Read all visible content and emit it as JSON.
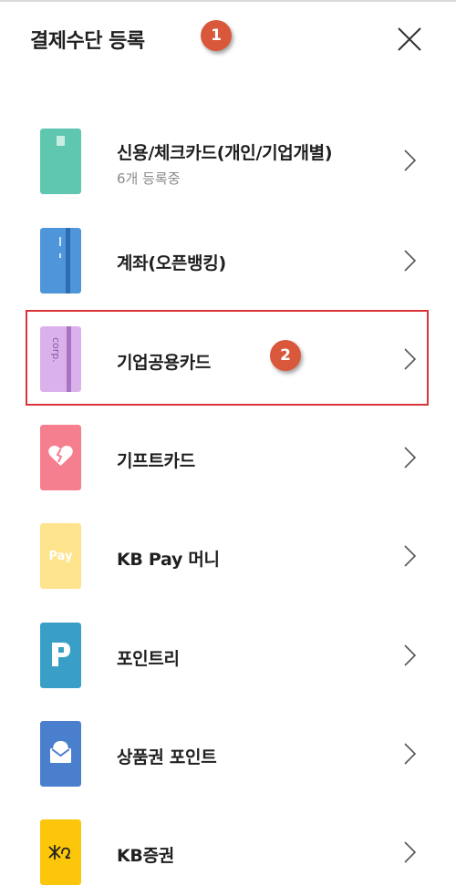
{
  "header": {
    "title": "결제수단 등록"
  },
  "badges": {
    "first": "1",
    "second": "2"
  },
  "methods": [
    {
      "label": "신용/체크카드(개인/기업개별)",
      "sub": "6개 등록중",
      "icon": "credit-card-icon",
      "color": "#5fc6b0"
    },
    {
      "label": "계좌(오픈뱅킹)",
      "icon": "bank-account-icon",
      "color": "#4f95d9"
    },
    {
      "label": "기업공용카드",
      "icon": "corp-card-icon",
      "color": "#dbb1eb",
      "icon_text": "corp."
    },
    {
      "label": "기프트카드",
      "icon": "gift-card-heart-icon",
      "color": "#f57e8f"
    },
    {
      "label": "KB Pay 머니",
      "icon": "pay-money-icon",
      "color": "#fee48d",
      "icon_text": "Pay"
    },
    {
      "label": "포인트리",
      "icon": "pointree-icon",
      "color": "#3a9fc7"
    },
    {
      "label": "상품권 포인트",
      "icon": "gift-voucher-icon",
      "color": "#4a7fcd"
    },
    {
      "label": "KB증권",
      "icon": "kb-securities-icon",
      "color": "#fcc60a"
    }
  ]
}
